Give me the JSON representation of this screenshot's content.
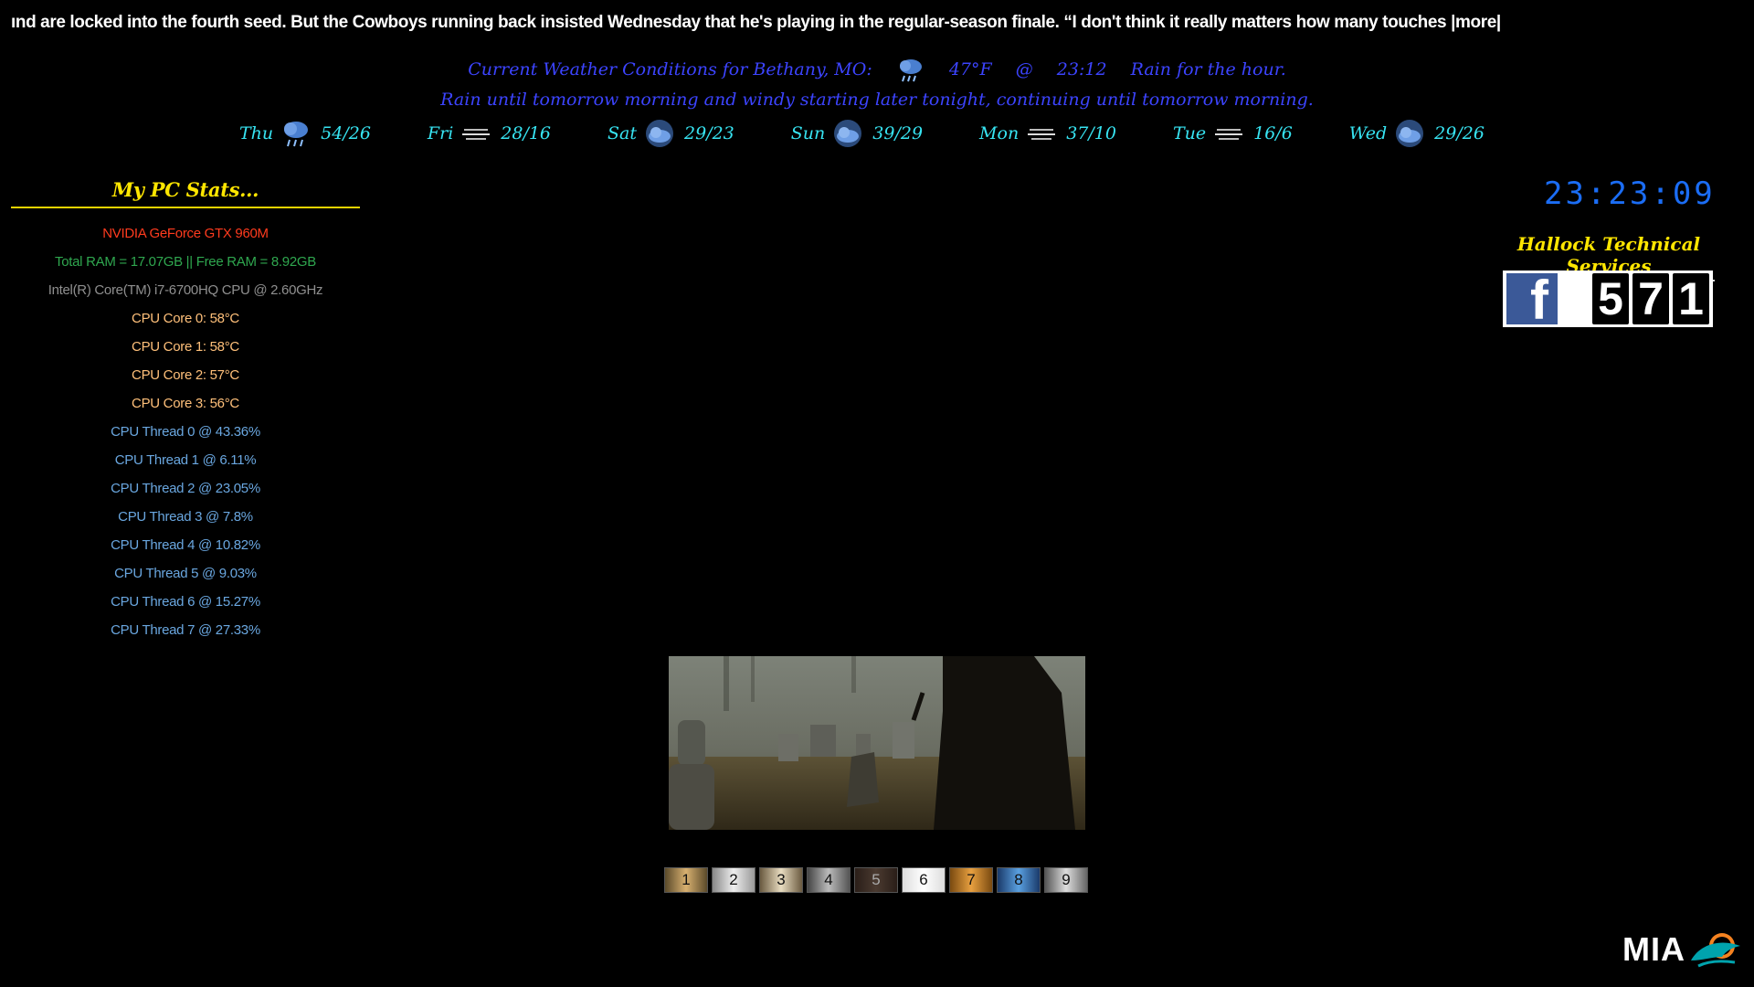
{
  "ticker": {
    "text": "ınd are locked into the fourth seed. But the Cowboys running back insisted Wednesday that he's playing in the regular-season finale. “I don't think it really matters how many touches |more|"
  },
  "weather": {
    "conditions_label": "Current Weather Conditions for Bethany, MO:",
    "condition_icon": "rain-cloud-icon",
    "temperature": "47°F",
    "at": "@",
    "time": "23:12",
    "summary_hour": "Rain for the hour.",
    "summary_day": "Rain until tomorrow morning and windy starting later tonight, continuing until tomorrow morning.",
    "text_color": "#3c44ff"
  },
  "forecast": [
    {
      "day": "Thu",
      "icon": "rain-cloud-icon",
      "temps": "54/26"
    },
    {
      "day": "Fri",
      "icon": "wind-icon",
      "temps": "28/16"
    },
    {
      "day": "Sat",
      "icon": "cloud-icon",
      "temps": "29/23"
    },
    {
      "day": "Sun",
      "icon": "cloud-icon",
      "temps": "39/29"
    },
    {
      "day": "Mon",
      "icon": "wind-icon",
      "temps": "37/10"
    },
    {
      "day": "Tue",
      "icon": "wind-icon",
      "temps": "16/6"
    },
    {
      "day": "Wed",
      "icon": "cloud-icon",
      "temps": "29/26"
    }
  ],
  "stats": {
    "title": "My PC Stats...",
    "gpu": "NVIDIA GeForce GTX 960M",
    "ram": "Total RAM = 17.07GB  ||  Free RAM = 8.92GB",
    "cpu": "Intel(R) Core(TM) i7-6700HQ CPU @ 2.60GHz",
    "cores": [
      "CPU Core 0:   58°C",
      "CPU Core 1:   58°C",
      "CPU Core 2:   57°C",
      "CPU Core 3:   56°C"
    ],
    "threads": [
      "CPU Thread 0   @   43.36%",
      "CPU Thread 1   @   6.11%",
      "CPU Thread 2   @   23.05%",
      "CPU Thread 3   @   7.8%",
      "CPU Thread 4   @   10.82%",
      "CPU Thread 5   @   9.03%",
      "CPU Thread 6   @   15.27%",
      "CPU Thread 7   @   27.33%"
    ]
  },
  "clock": {
    "time": "23:23:09"
  },
  "hts": {
    "title": "Hallock Technical Services",
    "facebook_icon": "facebook-icon",
    "digits": [
      "5",
      "7",
      "1"
    ]
  },
  "thumbnails": [
    "1",
    "2",
    "3",
    "4",
    "5",
    "6",
    "7",
    "8",
    "9"
  ],
  "team": {
    "abbr": "MIA",
    "logo": "dolphin-logo"
  }
}
